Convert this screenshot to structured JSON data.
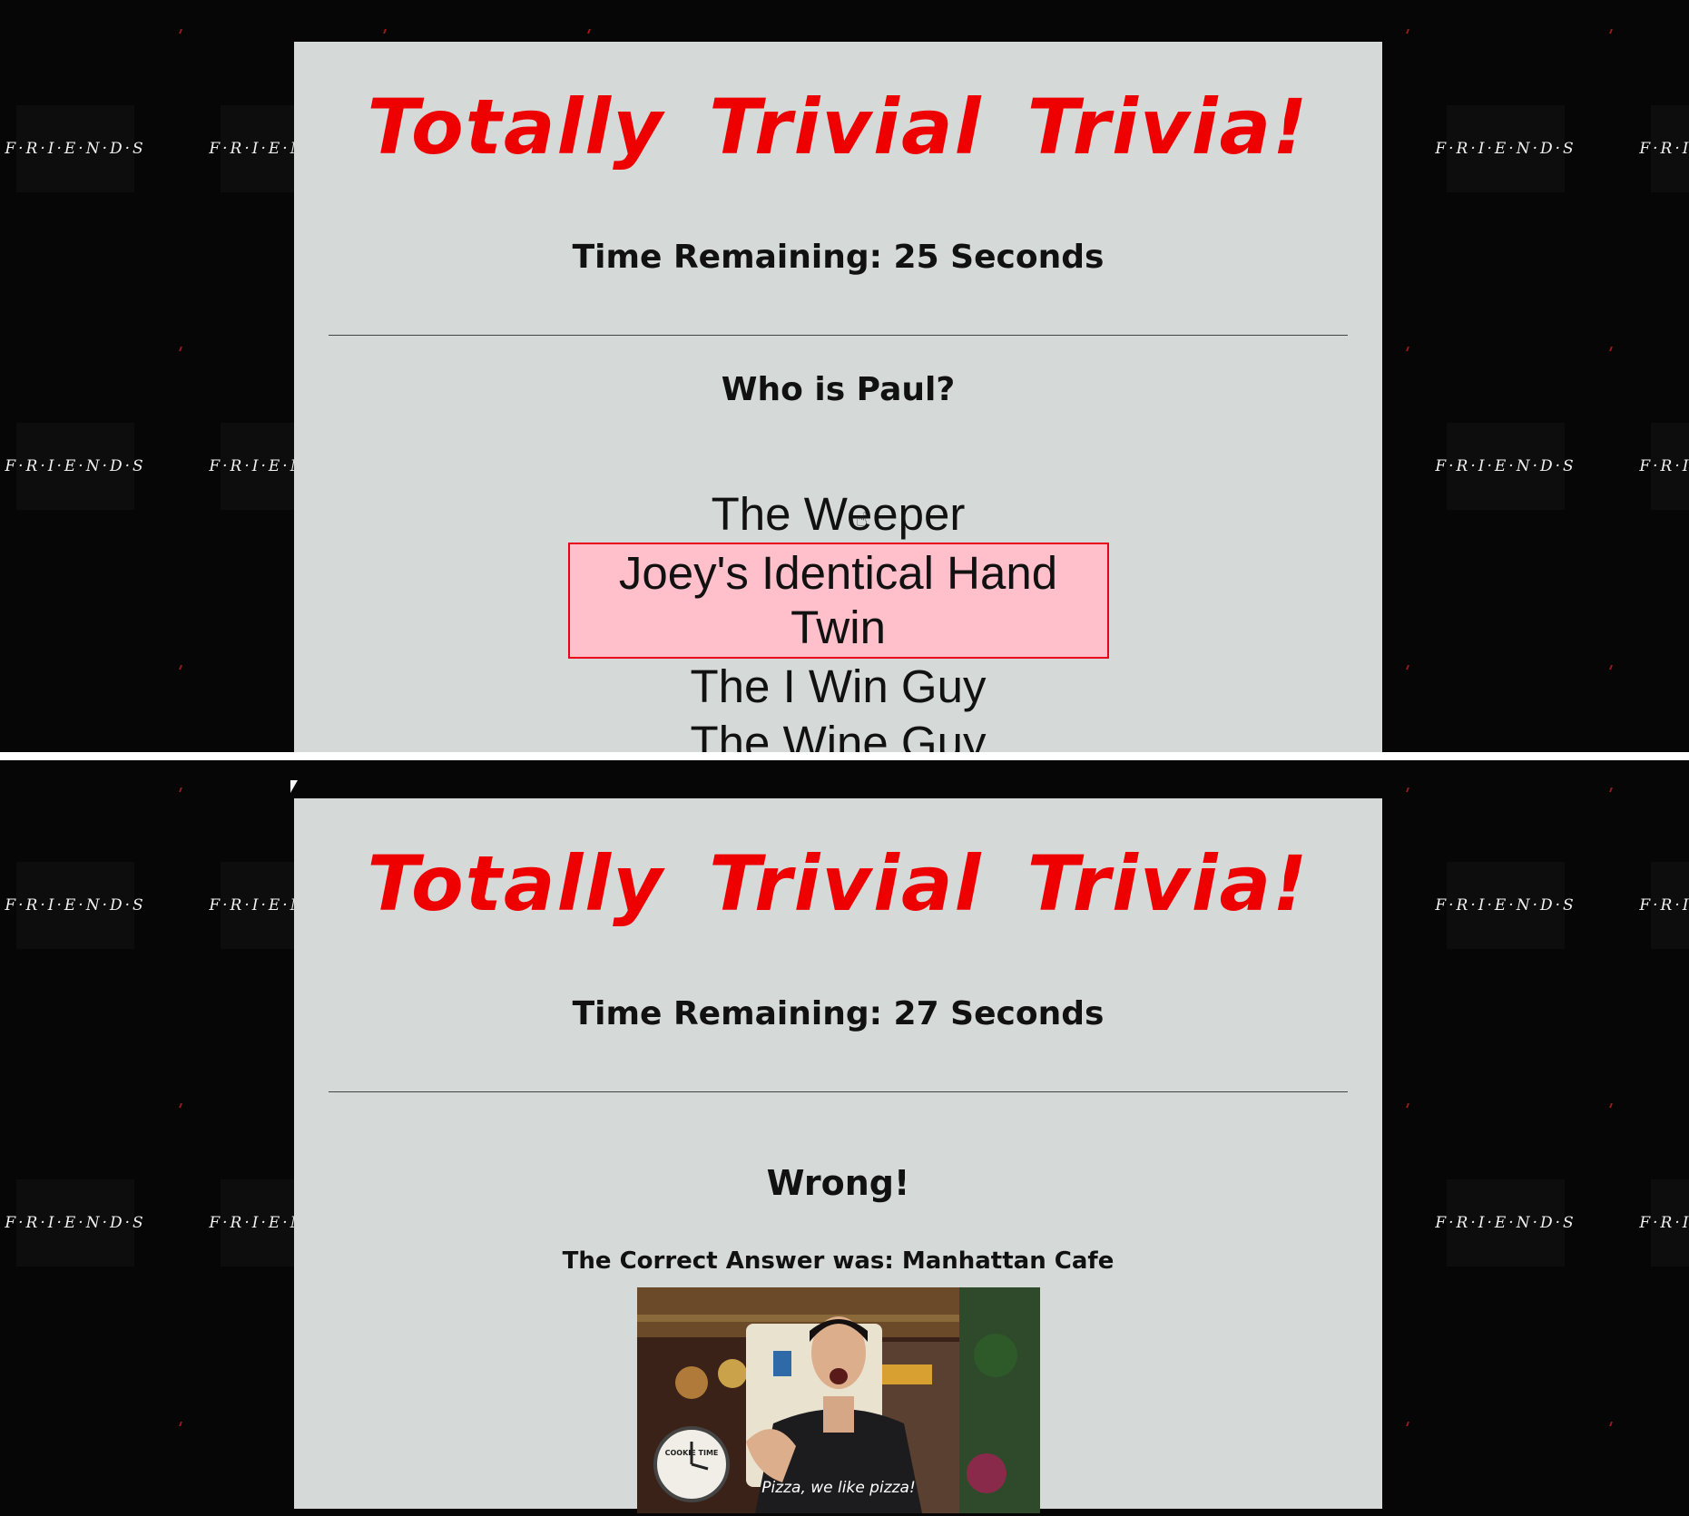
{
  "wallpaper": {
    "logo_text": "F·R·I·E·N·D·S"
  },
  "question_screen": {
    "title": "Totally Trivial Trivia!",
    "timer": "Time Remaining: 25 Seconds",
    "question": "Who is Paul?",
    "answers": [
      "The Weeper",
      "Joey's Identical Hand Twin",
      "The I Win Guy",
      "The Wine Guy"
    ]
  },
  "result_screen": {
    "title": "Totally Trivial Trivia!",
    "timer": "Time Remaining: 27 Seconds",
    "result": "Wrong!",
    "correct_answer": "The Correct Answer was: Manhattan Cafe",
    "gif": {
      "caption": "Pizza, we like pizza!",
      "clock_label": "COOKIE TIME"
    }
  },
  "colors": {
    "title": "#ee0000",
    "panel": "#d5d9d8",
    "hover_fill": "#ffc0cb",
    "hover_border": "#e8001c"
  }
}
